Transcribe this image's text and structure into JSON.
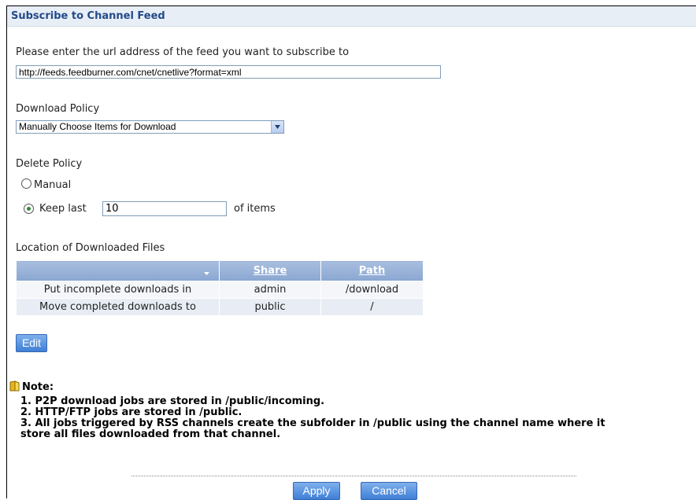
{
  "header": {
    "title": "Subscribe to Channel Feed"
  },
  "url": {
    "prompt": "Please enter the url address of the feed you want to subscribe to",
    "value": "http://feeds.feedburner.com/cnet/cnetlive?format=xml"
  },
  "download_policy": {
    "label": "Download Policy",
    "selected": "Manually Choose Items for Download"
  },
  "delete_policy": {
    "label": "Delete Policy",
    "manual_label": "Manual",
    "keep_last_label": "Keep last",
    "keep_last_value": "10",
    "keep_last_suffix": "of items",
    "selected": "keep_last"
  },
  "location": {
    "label": "Location of Downloaded Files",
    "columns": [
      "",
      "Share",
      "Path"
    ],
    "rows": [
      {
        "name": "Put incomplete downloads in",
        "share": "admin",
        "path": "/download"
      },
      {
        "name": "Move completed downloads to",
        "share": "public",
        "path": "/"
      }
    ],
    "edit_label": "Edit"
  },
  "note": {
    "title": "Note:",
    "lines": [
      "1. P2P download jobs are stored in /public/incoming.",
      "2. HTTP/FTP jobs are stored in /public.",
      "3. All jobs triggered by RSS channels create the subfolder in /public using the channel name where it",
      "store all files downloaded from that channel."
    ]
  },
  "footer": {
    "apply_label": "Apply",
    "cancel_label": "Cancel"
  },
  "colors": {
    "header_text": "#224a8a",
    "table_header": "#8aa6d1",
    "button": "#3f7fd6",
    "radio_selected": "#2e8b3a"
  }
}
